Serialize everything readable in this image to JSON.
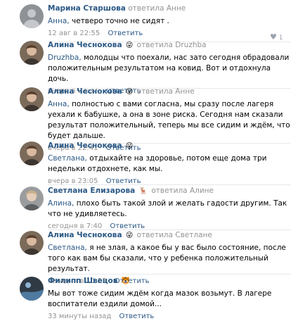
{
  "comments": [
    {
      "author": "Марина Старшова",
      "emoji": "",
      "replied_to": "ответила Анне",
      "mention": "Анна,",
      "text": " четверо точно не сидят .",
      "date": "12 авг в 22:55",
      "reply_label": "Ответить",
      "like_count": "1",
      "avatar_icon": "avatar-grey"
    },
    {
      "author": "Алина Чеснокова",
      "emoji": "😜",
      "replied_to": "ответила Druzhba",
      "mention": "Druzhba,",
      "text": " молодцы что поехали, нас зато сегодня обрадовали положительным результатом на ковид. Вот и отдохнула дочь.",
      "date": "вчера в 22:37",
      "reply_label": "Ответить",
      "avatar_icon": "avatar-photo-brown"
    },
    {
      "author": "Алина Чеснокова",
      "emoji": "😜",
      "replied_to": "ответила Анне",
      "mention": "Анна,",
      "text": " полностью с вами согласна, мы сразу после лагеря уехали к бабушке, а она в зоне риска. Сегодня нам сказали результат положительный, теперь мы все сидим и ждём, что будет дальше.",
      "date": "вчера в 22:41",
      "reply_label": "Ответить",
      "avatar_icon": "avatar-photo-brown"
    },
    {
      "author": "Алина Чеснокова",
      "emoji": "😜",
      "replied_to": "",
      "mention": "Светлана,",
      "text": " отдыхайте на здоровье, потом еще дома три недельки отдохнете, как мы.",
      "date": "вчера в 23:05",
      "reply_label": "Ответить",
      "avatar_icon": "avatar-photo-brown"
    },
    {
      "author": "Светлана Елизарова",
      "emoji": "🦌",
      "replied_to": "ответила Алине",
      "mention": "Алина,",
      "text": " плохо быть такой злой и желать гадости другим. Так что не удивляетесь.",
      "date": "сегодня в 7:40",
      "reply_label": "Ответить",
      "avatar_icon": "avatar-photo-grey"
    },
    {
      "author": "Алина Чеснокова",
      "emoji": "😜",
      "replied_to": "ответила Светлане",
      "mention": "Светлана,",
      "text": " я не злая, а какое бы у вас было состояние, после того как вам бы сказали, что у ребенка положительный результат.",
      "date": "сегодня в 10:23",
      "reply_label": "Ответить",
      "avatar_icon": "avatar-photo-brown"
    },
    {
      "author": "Филипп Швецов",
      "emoji": "🐯",
      "replied_to": "",
      "mention": "",
      "text": "Мы вот тоже сидим ждём когда мазок возьмут. В лагере воспитатели ездили домой...",
      "date": "33 минуты назад",
      "reply_label": "Ответить",
      "avatar_icon": "avatar-photo-blue"
    }
  ]
}
